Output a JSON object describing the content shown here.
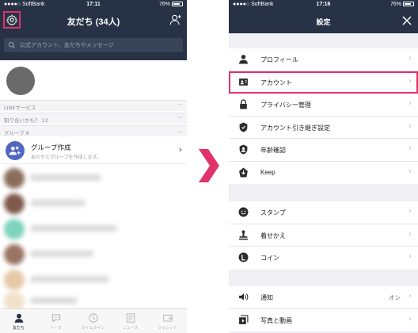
{
  "left": {
    "status": {
      "carrier": "●●●●○ SoftBank",
      "time": "17:11",
      "battery": "76%"
    },
    "title": "友だち (34人)",
    "search_placeholder": "公式アカウント、友だちやメッセージ",
    "sections": {
      "line_services": "LINEサービス",
      "maybe_know": "知り合いかも？ 12",
      "group": "グループ 8"
    },
    "group_create": {
      "title": "グループ作成",
      "subtitle": "友だちとグループを作成します。"
    },
    "tabs": [
      {
        "label": "友だち",
        "icon": "person-icon",
        "active": true
      },
      {
        "label": "トーク",
        "icon": "chat-icon",
        "active": false
      },
      {
        "label": "タイムライン",
        "icon": "clock-icon",
        "active": false
      },
      {
        "label": "ニュース",
        "icon": "news-icon",
        "active": false
      },
      {
        "label": "ウォレット",
        "icon": "wallet-icon",
        "active": false
      }
    ]
  },
  "right": {
    "status": {
      "carrier": "●●●●○ SoftBank",
      "time": "17:16",
      "battery": "76%"
    },
    "title": "設定",
    "groups": [
      [
        {
          "label": "プロフィール",
          "icon": "person-icon"
        },
        {
          "label": "アカウント",
          "icon": "account-card-icon",
          "highlight": true
        },
        {
          "label": "プライバシー管理",
          "icon": "lock-icon"
        },
        {
          "label": "アカウント引き継ぎ設定",
          "icon": "shield-icon"
        },
        {
          "label": "年齢確認",
          "icon": "age-shield-icon"
        },
        {
          "label": "Keep",
          "icon": "keep-icon"
        }
      ],
      [
        {
          "label": "スタンプ",
          "icon": "smile-icon"
        },
        {
          "label": "着せかえ",
          "icon": "brush-icon"
        },
        {
          "label": "コイン",
          "icon": "coin-icon"
        }
      ],
      [
        {
          "label": "通知",
          "icon": "speaker-icon",
          "value": "オン"
        },
        {
          "label": "写真と動画",
          "icon": "photo-icon"
        }
      ]
    ]
  },
  "colors": {
    "header": "#273246",
    "highlight": "#e0336a",
    "group_icon": "#5068c2"
  }
}
